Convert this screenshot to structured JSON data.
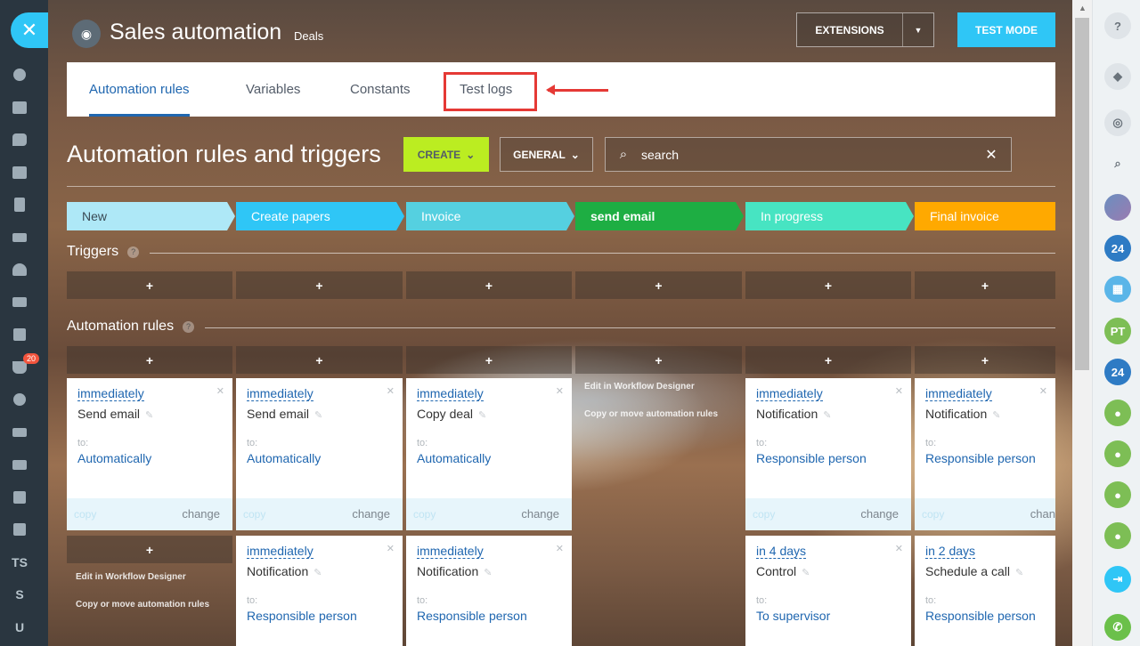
{
  "header": {
    "app_title": "Sales automation",
    "app_subtitle": "Deals",
    "extensions_label": "EXTENSIONS",
    "test_mode_label": "TEST MODE"
  },
  "tabs": [
    {
      "label": "Automation rules",
      "active": true
    },
    {
      "label": "Variables"
    },
    {
      "label": "Constants"
    },
    {
      "label": "Test logs"
    }
  ],
  "toolbar": {
    "page_title": "Automation rules and triggers",
    "create_label": "CREATE",
    "general_label": "GENERAL",
    "search_placeholder": "search"
  },
  "stages": [
    {
      "name": "New",
      "color": "#aee8f7",
      "text_color": "#3b4a55"
    },
    {
      "name": "Create papers",
      "color": "#2fc6f6",
      "text_color": "#ffffff"
    },
    {
      "name": "Invoice",
      "color": "#55d0e0",
      "text_color": "#ffffff"
    },
    {
      "name": "send email",
      "color": "#1eae43",
      "text_color": "#ffffff"
    },
    {
      "name": "In progress",
      "color": "#47e4c2",
      "text_color": "#ffffff"
    },
    {
      "name": "Final invoice",
      "color": "#ffa900",
      "text_color": "#ffffff"
    }
  ],
  "sections": {
    "triggers": "Triggers",
    "automation_rules": "Automation rules"
  },
  "workflow_links": {
    "edit": "Edit in Workflow Designer",
    "copy_move": "Copy or move automation rules"
  },
  "cards": {
    "c1": {
      "when": "immediately",
      "action": "Send email",
      "to": "to:",
      "who": "Automatically",
      "copy": "copy",
      "change": "change"
    },
    "c2": {
      "when": "immediately",
      "action": "Send email",
      "to": "to:",
      "who": "Automatically",
      "copy": "copy",
      "change": "change"
    },
    "c3": {
      "when": "immediately",
      "action": "Copy deal",
      "to": "to:",
      "who": "Automatically",
      "copy": "copy",
      "change": "change"
    },
    "c5": {
      "when": "immediately",
      "action": "Notification",
      "to": "to:",
      "who": "Responsible person",
      "copy": "copy",
      "change": "change"
    },
    "c6": {
      "when": "immediately",
      "action": "Notification",
      "to": "to:",
      "who": "Responsible person",
      "copy": "copy",
      "change": "chan"
    },
    "r2c2": {
      "when": "immediately",
      "action": "Notification",
      "to": "to:",
      "who": "Responsible person"
    },
    "r2c3": {
      "when": "immediately",
      "action": "Notification",
      "to": "to:",
      "who": "Responsible person"
    },
    "r2c5": {
      "when": "in 4 days",
      "action": "Control",
      "to": "to:",
      "who": "To supervisor"
    },
    "r2c6": {
      "when": "in 2 days",
      "action": "Schedule a call",
      "to": "to:",
      "who": "Responsible person"
    }
  },
  "left_sidebar": {
    "counter_badge": "20",
    "text_items": [
      "TS",
      "S",
      "U"
    ]
  },
  "right_sidebar": {
    "initials": "PT",
    "b24_label": "24"
  },
  "colors": {
    "accent_blue": "#2fc6f6",
    "create_green": "#bbed21",
    "link_blue": "#2067b0",
    "highlight_red": "#e53935"
  }
}
